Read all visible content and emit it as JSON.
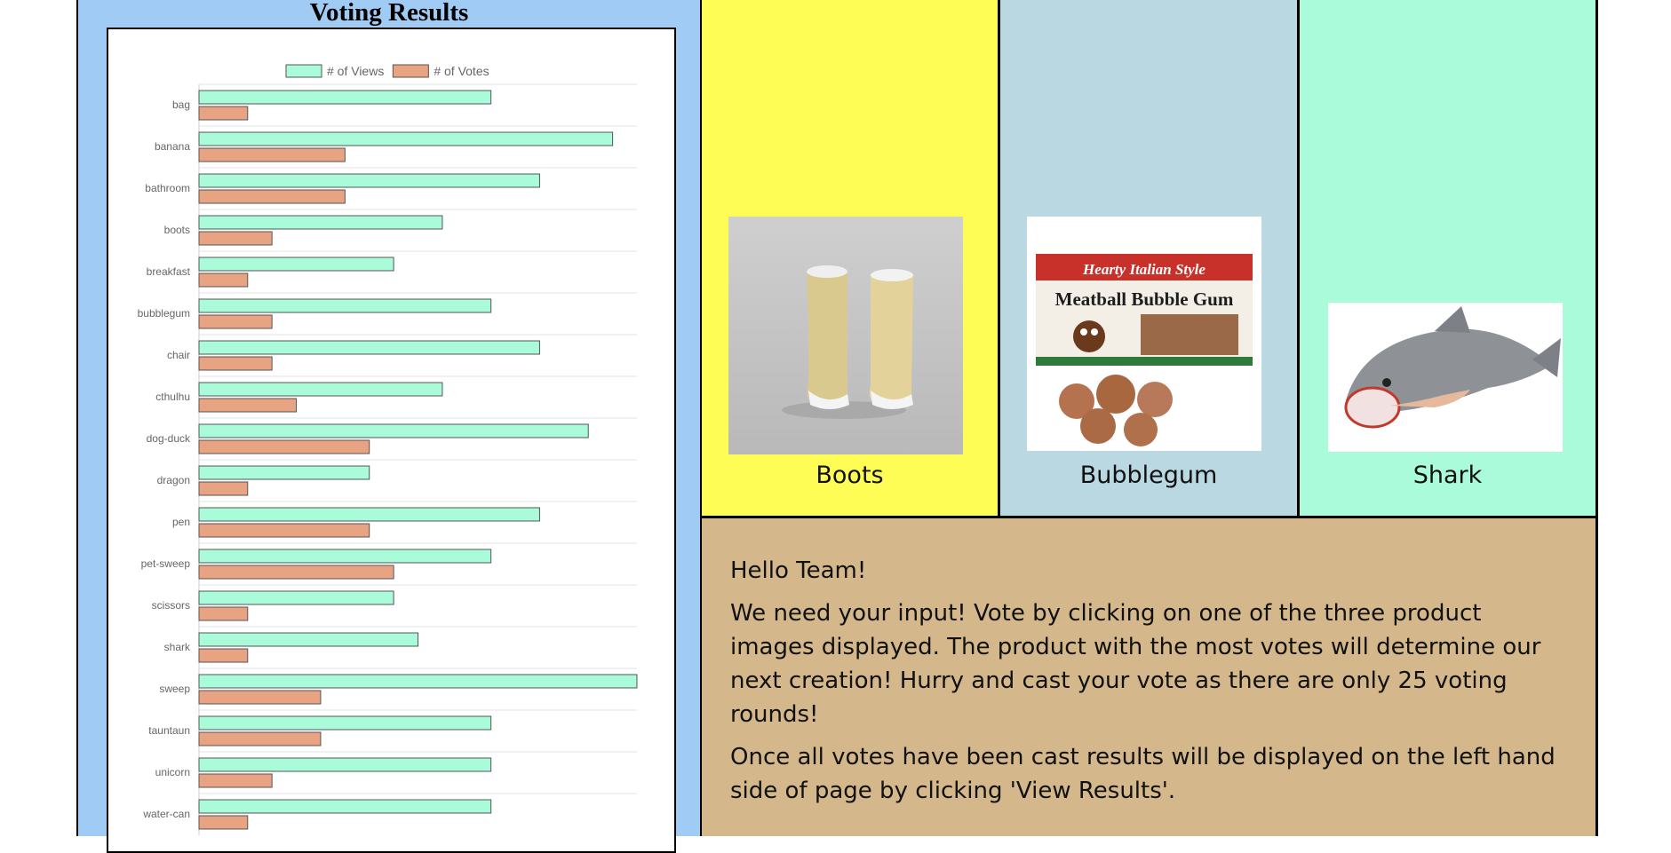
{
  "results": {
    "title": "Voting Results"
  },
  "chart_data": {
    "type": "bar",
    "orientation": "horizontal",
    "categories": [
      "bag",
      "banana",
      "bathroom",
      "boots",
      "breakfast",
      "bubblegum",
      "chair",
      "cthulhu",
      "dog-duck",
      "dragon",
      "pen",
      "pet-sweep",
      "scissors",
      "shark",
      "sweep",
      "tauntaun",
      "unicorn",
      "water-can"
    ],
    "series": [
      {
        "name": "# of Views",
        "values": [
          12,
          17,
          14,
          10,
          8,
          12,
          14,
          10,
          16,
          7,
          14,
          12,
          8,
          9,
          18,
          12,
          12,
          12
        ],
        "color": "#aafbda"
      },
      {
        "name": "# of Votes",
        "values": [
          2,
          6,
          6,
          3,
          2,
          3,
          3,
          4,
          7,
          2,
          7,
          8,
          2,
          2,
          5,
          5,
          3,
          2
        ],
        "color": "#e8a383"
      }
    ],
    "xlim": [
      0,
      18
    ],
    "legend_position": "top",
    "grid": true
  },
  "products": [
    {
      "name": "Boots",
      "image": "rain boots"
    },
    {
      "name": "Bubblegum",
      "image": "meatball bubble gum package"
    },
    {
      "name": "Shark",
      "image": "shark sleeping bag"
    }
  ],
  "bubblegum_package": {
    "line1": "Hearty Italian Style",
    "line2": "Meatball Bubble Gum"
  },
  "message": {
    "greeting": "Hello Team!",
    "paragraph1": "We need your input! Vote by clicking on one of the three product images displayed. The product with the most votes will determine our next creation! Hurry and cast your vote as there are only 25 voting rounds!",
    "paragraph2": "Once all votes have been cast results will be displayed on the left hand side of page by clicking 'View Results'."
  }
}
